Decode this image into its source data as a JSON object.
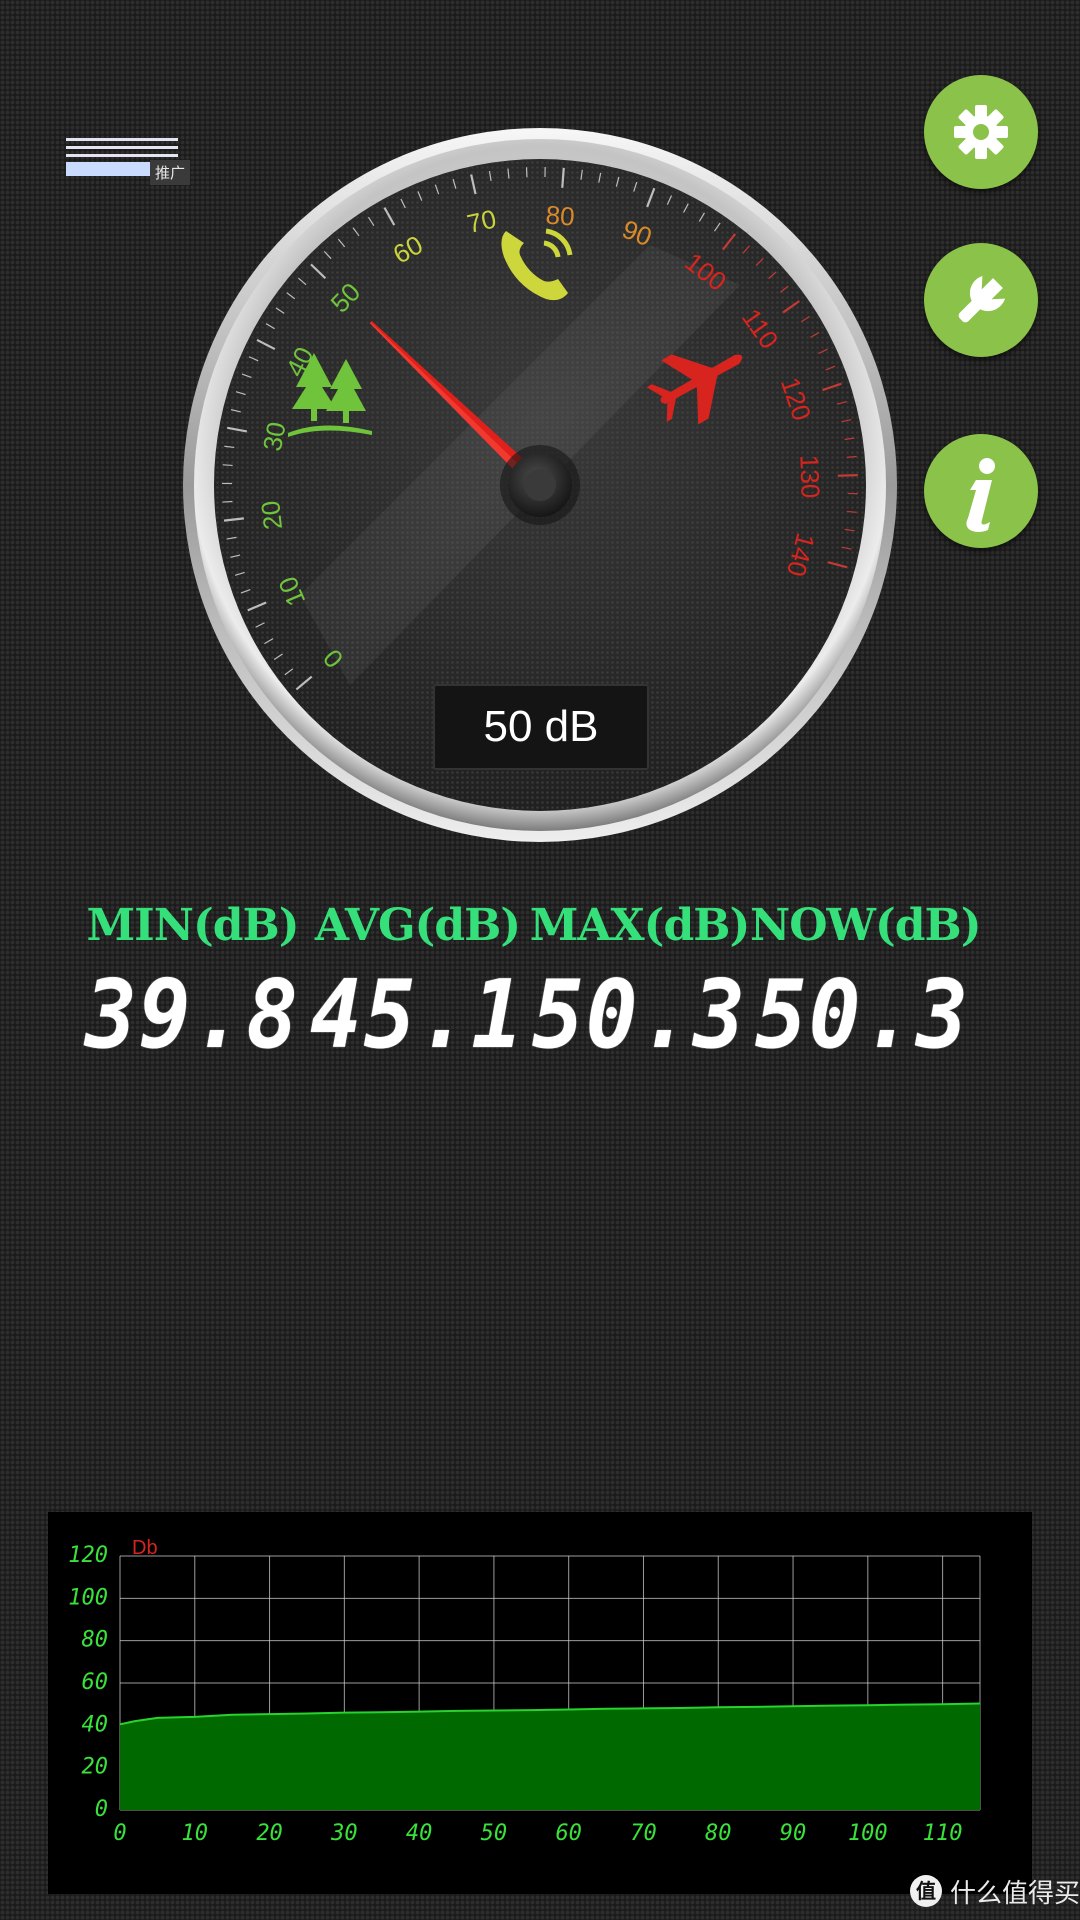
{
  "ad_badge": {
    "label": "推广"
  },
  "gauge": {
    "current_value": 50,
    "readout": "50 dB",
    "scale_min": 0,
    "scale_max": 140,
    "scale_labels": [
      "0",
      "10",
      "20",
      "30",
      "40",
      "50",
      "60",
      "70",
      "80",
      "90",
      "100",
      "110",
      "120",
      "130",
      "140"
    ],
    "zone_icons": [
      "trees-icon",
      "phone-ringing-icon",
      "airplane-icon"
    ],
    "colors": {
      "low": "#6fc43c",
      "mid": "#c9d43c",
      "warm": "#d98a2a",
      "high": "#d8241e",
      "needle": "#e0201b"
    }
  },
  "side_buttons": [
    {
      "name": "settings-button",
      "icon": "gear-icon"
    },
    {
      "name": "tools-button",
      "icon": "wrench-icon"
    },
    {
      "name": "info-button",
      "icon": "info-icon"
    }
  ],
  "stats": [
    {
      "label": "MIN(dB)",
      "value": "39.8"
    },
    {
      "label": "AVG(dB)",
      "value": "45.1"
    },
    {
      "label": "MAX(dB)",
      "value": "50.3"
    },
    {
      "label": "NOW(dB)",
      "value": "50.3"
    }
  ],
  "chart_data": {
    "type": "area",
    "ylabel": "Db",
    "xlabel": "",
    "ylim": [
      0,
      120
    ],
    "xlim": [
      0,
      115
    ],
    "yticks": [
      "0",
      "20",
      "40",
      "60",
      "80",
      "100",
      "120"
    ],
    "xticks": [
      "0",
      "10",
      "20",
      "30",
      "40",
      "50",
      "60",
      "70",
      "80",
      "90",
      "100",
      "110"
    ],
    "grid": true,
    "colors": {
      "fill": "#006a00",
      "line": "#29d22f",
      "grid": "#d0d0d0",
      "ticks": "#39e23b",
      "ylabel": "#d8241e"
    },
    "series": [
      {
        "x": [
          0,
          2,
          5,
          8,
          10,
          15,
          20,
          25,
          30,
          35,
          40,
          45,
          50,
          55,
          60,
          65,
          70,
          75,
          80,
          85,
          90,
          95,
          100,
          105,
          110,
          115
        ],
        "y": [
          40.5,
          42,
          43.5,
          43.8,
          44,
          45,
          45.3,
          45.6,
          46,
          46.2,
          46.5,
          46.8,
          47,
          47.2,
          47.5,
          47.8,
          48,
          48.2,
          48.5,
          48.7,
          49,
          49.3,
          49.5,
          49.8,
          50,
          50.3
        ]
      }
    ]
  },
  "watermark": {
    "logo": "值",
    "text": "什么值得买"
  }
}
